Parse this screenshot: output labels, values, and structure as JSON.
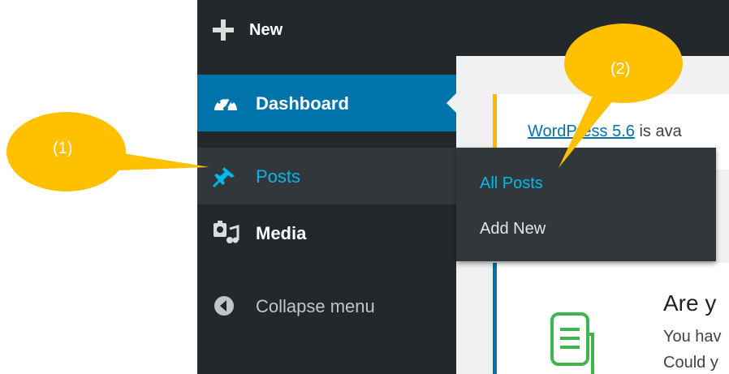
{
  "toolbar": {
    "new_label": "New"
  },
  "notice": {
    "link_text": "WordPress 5.6",
    "rest_text": " is ava"
  },
  "panel": {
    "title": "Are y",
    "line1": "You hav",
    "line2": "Could y"
  },
  "sidebar": {
    "items": [
      {
        "label": "Dashboard",
        "icon": "dashboard-gauge-icon"
      },
      {
        "label": "Posts",
        "icon": "pin-icon"
      },
      {
        "label": "Media",
        "icon": "media-icon"
      },
      {
        "label": "Collapse menu",
        "icon": "collapse-arrow-icon"
      }
    ]
  },
  "submenu": {
    "items": [
      {
        "label": "All Posts"
      },
      {
        "label": "Add New"
      }
    ]
  },
  "callouts": [
    {
      "label": "(1)"
    },
    {
      "label": "(2)"
    }
  ],
  "colors": {
    "sidebar_bg": "#23282d",
    "active_item": "#0073aa",
    "highlight_text": "#00b9eb",
    "callout": "#ffc000",
    "notice_border": "#ffb900"
  }
}
